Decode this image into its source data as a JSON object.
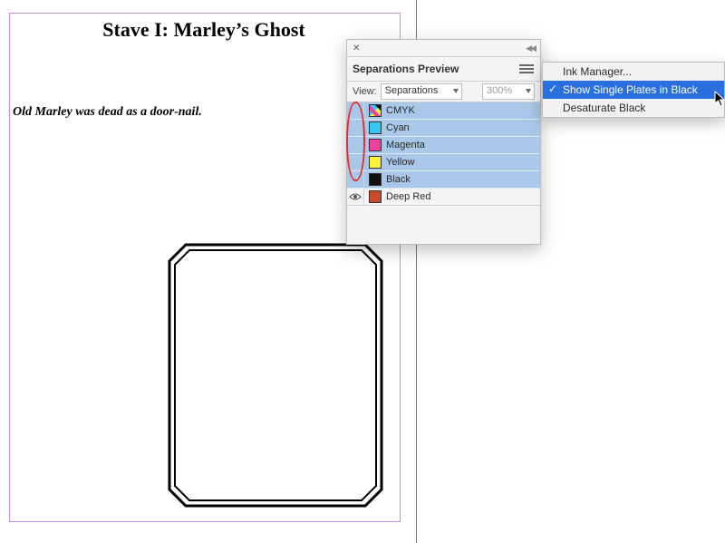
{
  "document": {
    "heading": "Stave I: Marley’s Ghost",
    "body_line": "Old Marley was dead as a door-nail."
  },
  "panel": {
    "title": "Separations Preview",
    "view_label": "View:",
    "view_value": "Separations",
    "zoom_value": "300%",
    "inks": [
      {
        "name": "CMYK",
        "color": "cmyk",
        "eye": false
      },
      {
        "name": "Cyan",
        "color": "#36c7f4",
        "eye": false
      },
      {
        "name": "Magenta",
        "color": "#ef3fa1",
        "eye": false
      },
      {
        "name": "Yellow",
        "color": "#fff23a",
        "eye": false
      },
      {
        "name": "Black",
        "color": "#111111",
        "eye": false
      },
      {
        "name": "Deep Red",
        "color": "#c84a2b",
        "eye": true
      }
    ]
  },
  "flyout": {
    "items": [
      {
        "label": "Ink Manager...",
        "checked": false,
        "selected": false
      },
      {
        "label": "Show Single Plates in Black",
        "checked": true,
        "selected": true
      },
      {
        "label": "Desaturate Black",
        "checked": false,
        "selected": false
      }
    ]
  }
}
